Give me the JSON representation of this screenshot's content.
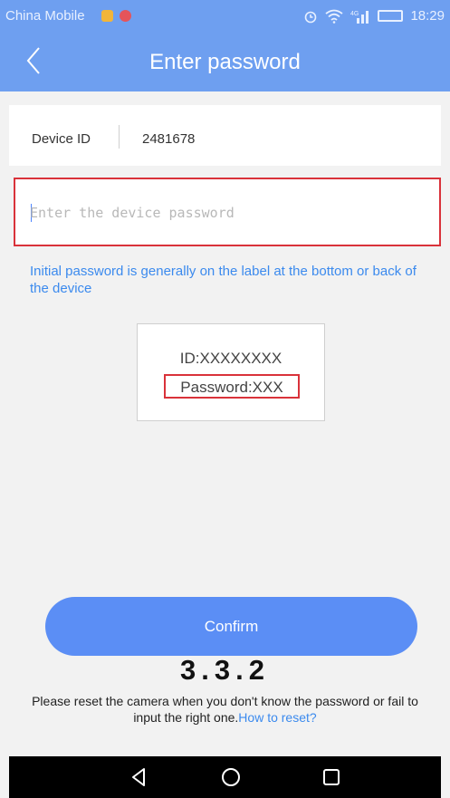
{
  "status_bar": {
    "carrier": "China Mobile",
    "time": "18:29",
    "network": "4G"
  },
  "header": {
    "title": "Enter password",
    "back_icon": "chevron-left-icon"
  },
  "device": {
    "label": "Device ID",
    "value": "2481678"
  },
  "password_field": {
    "placeholder": "Enter the device password",
    "value": ""
  },
  "hint": {
    "text": "Initial password is generally on the label at the bottom or back of the device"
  },
  "label_example": {
    "id_line": "ID:XXXXXXXX",
    "password_line": "Password:XXX"
  },
  "confirm_button": {
    "label": "Confirm"
  },
  "version": {
    "text": "3.3.2"
  },
  "reset_note": {
    "text": "Please reset the camera when you don't know the password or fail to input the right one.",
    "link": "How to reset?"
  },
  "colors": {
    "accent": "#6e9ff0",
    "button": "#5b8ef5",
    "link": "#3b8aee",
    "highlight_border": "#d9323a"
  }
}
